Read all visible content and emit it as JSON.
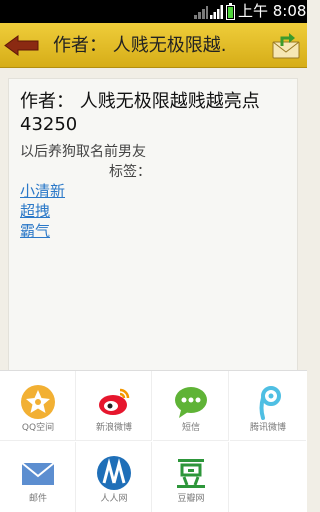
{
  "status_bar": {
    "time": "上午 8:08"
  },
  "title_bar": {
    "title": "作者： 人贱无极限越."
  },
  "article": {
    "title": "作者： 人贱无极限越贱越亮点43250",
    "body": "以后养狗取名前男友",
    "tags_label": "标签：",
    "tags": [
      "小清新",
      "超拽",
      "霸气"
    ]
  },
  "share_menu": {
    "items": [
      {
        "label": "QQ空间",
        "icon": "qzone-icon"
      },
      {
        "label": "新浪微博",
        "icon": "sina-weibo-icon"
      },
      {
        "label": "短信",
        "icon": "sms-icon"
      },
      {
        "label": "腾讯微博",
        "icon": "tencent-weibo-icon"
      },
      {
        "label": "邮件",
        "icon": "mail-icon"
      },
      {
        "label": "人人网",
        "icon": "renren-icon"
      },
      {
        "label": "豆瓣网",
        "icon": "douban-icon"
      }
    ]
  },
  "colors": {
    "title_bar": "#e3be2a",
    "link": "#2a78c8",
    "background": "#f1eee6"
  }
}
